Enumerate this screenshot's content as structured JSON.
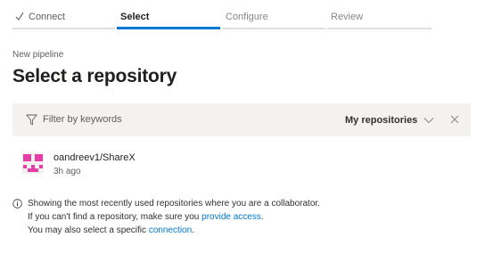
{
  "steps": [
    {
      "label": "Connect",
      "state": "done"
    },
    {
      "label": "Select",
      "state": "active"
    },
    {
      "label": "Configure",
      "state": "pending"
    },
    {
      "label": "Review",
      "state": "pending"
    }
  ],
  "header": {
    "breadcrumb": "New pipeline",
    "title": "Select a repository"
  },
  "filter": {
    "placeholder": "Filter by keywords",
    "scope_label": "My repositories"
  },
  "repositories": [
    {
      "name": "oandreev1/ShareX",
      "time": "3h ago"
    }
  ],
  "info": {
    "line1": "Showing the most recently used repositories where you are a collaborator.",
    "line2_prefix": "If you can't find a repository, make sure you ",
    "line2_link": "provide access",
    "line2_suffix": ".",
    "line3_prefix": "You may also select a specific ",
    "line3_link": "connection",
    "line3_suffix": "."
  },
  "colors": {
    "accent": "#0078d4",
    "avatar": "#e3008c",
    "filter_bg": "#f3f2f1"
  },
  "icons": {
    "done_step": "check-icon",
    "filter": "filter-icon",
    "scope_dropdown": "chevron-down-icon",
    "clear_filter": "close-icon",
    "info": "info-icon",
    "repo_avatar": "identicon-avatar"
  }
}
